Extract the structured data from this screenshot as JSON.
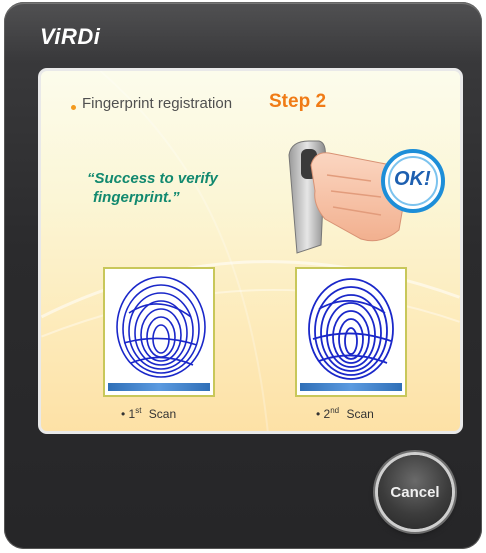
{
  "app": {
    "logo": "ViRDi"
  },
  "panel": {
    "title": "Fingerprint registration",
    "step": "Step 2",
    "message_line1": "“Success to verify",
    "message_line2": "fingerprint.”",
    "ok_badge": "OK!"
  },
  "scans": [
    {
      "prefix": "• 1",
      "suffix": "st",
      "label": "Scan"
    },
    {
      "prefix": "• 2",
      "suffix": "nd",
      "label": "Scan"
    }
  ],
  "buttons": {
    "cancel": "Cancel"
  },
  "colors": {
    "accent": "#f07b16",
    "message": "#12896f",
    "fingerprint": "#1a27c9",
    "ok": "#1d8ed8"
  }
}
